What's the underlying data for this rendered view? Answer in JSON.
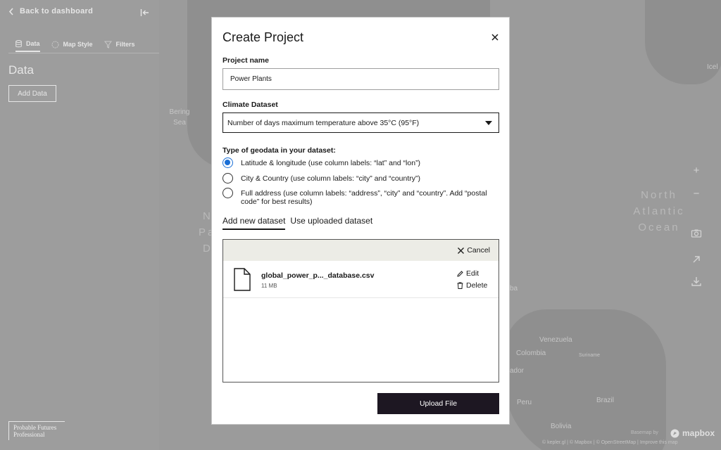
{
  "sidebar": {
    "back_label": "Back to dashboard",
    "tabs": [
      {
        "label": "Data",
        "icon": "database-icon"
      },
      {
        "label": "Map Style",
        "icon": "palette-icon"
      },
      {
        "label": "Filters",
        "icon": "filter-icon"
      }
    ],
    "title": "Data",
    "add_data_label": "Add Data",
    "brand_line1": "Probable Futures",
    "brand_line2": "Professional"
  },
  "map": {
    "labels": {
      "bering_1": "Bering",
      "bering_2": "Sea",
      "ocean_1": "North",
      "ocean_2": "Atlantic",
      "ocean_3": "Ocean",
      "venezuela": "Venezuela",
      "colombia": "Colombia",
      "suriname": "Suriname",
      "peru": "Peru",
      "brazil": "Brazil",
      "bolivia": "Bolivia",
      "icel": "Icel",
      "ador": "ador",
      "ba": "ba",
      "n": "N",
      "pa": "Pa",
      "d": "D"
    },
    "basemap_label": "Basemap by",
    "mapbox_label": "mapbox",
    "attribution": "© kepler.gl | © Mapbox | © OpenStreetMap | Improve this map",
    "controls": [
      "zoom-in-icon",
      "zoom-out-icon",
      "camera-icon",
      "share-icon",
      "download-icon"
    ]
  },
  "modal": {
    "title": "Create Project",
    "project_name_label": "Project name",
    "project_name_value": "Power Plants",
    "climate_label": "Climate Dataset",
    "climate_value": "Number of days maximum temperature above 35°C (95°F)",
    "geodata_label": "Type of geodata in your dataset:",
    "geodata_options": [
      {
        "label": "Latitude & longitude (use column labels: “lat” and “lon”)",
        "selected": true
      },
      {
        "label": "City & Country (use column labels: “city” and “country”)",
        "selected": false
      },
      {
        "label": "Full address (use column labels: “address”, “city” and “country”. Add “postal code” for best results)",
        "selected": false
      }
    ],
    "dataset_tabs": [
      {
        "label": "Add new dataset",
        "active": true
      },
      {
        "label": "Use uploaded dataset",
        "active": false
      }
    ],
    "cancel_label": "Cancel",
    "file": {
      "name": "global_power_p..._database.csv",
      "size": "11 MB",
      "edit_label": "Edit",
      "delete_label": "Delete"
    },
    "upload_label": "Upload File"
  },
  "colors": {
    "accent": "#1a6fd6",
    "button_dark": "#1d1722",
    "upload_header": "#ecece6",
    "overlay_gray": "#9b9b9b"
  }
}
